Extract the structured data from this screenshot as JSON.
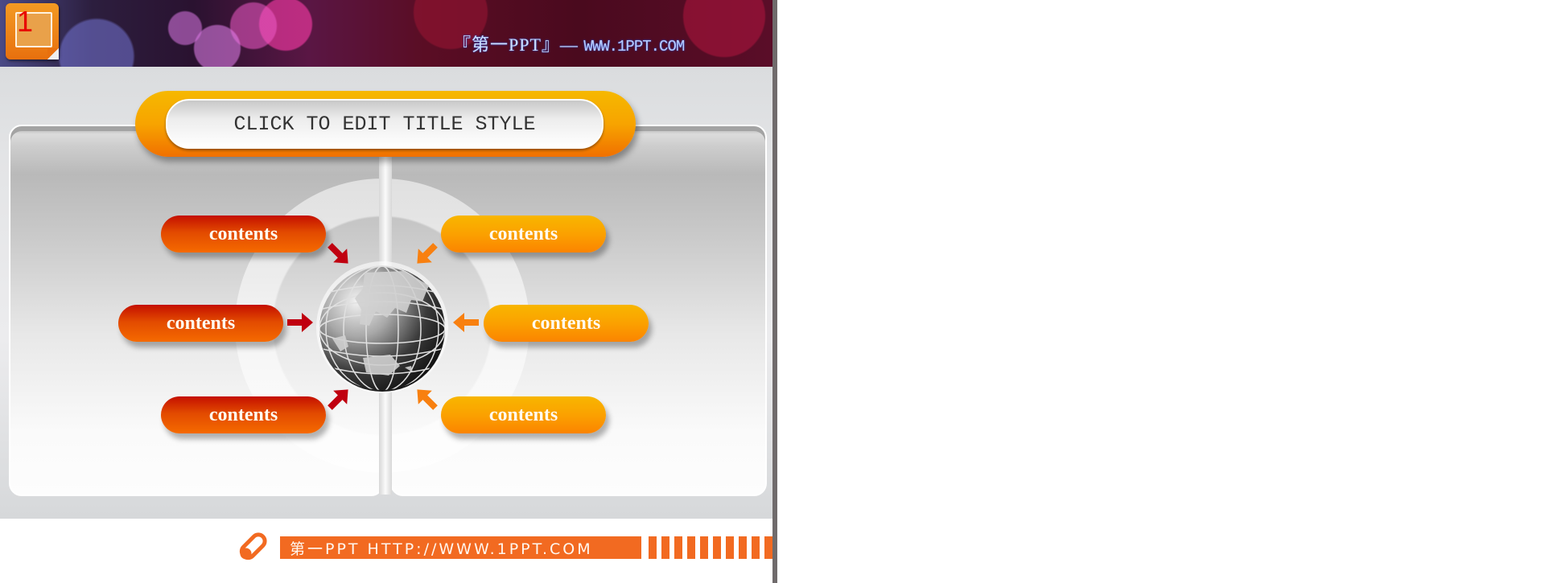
{
  "slide": {
    "slide_number": "1",
    "header": {
      "brand_text": "『第一PPT』—",
      "url_text": "WWW.1PPT.COM"
    },
    "title": "CLICK TO EDIT TITLE STYLE",
    "left_items": [
      {
        "label": "contents"
      },
      {
        "label": "contents"
      },
      {
        "label": "contents"
      }
    ],
    "right_items": [
      {
        "label": "contents"
      },
      {
        "label": "contents"
      },
      {
        "label": "contents"
      }
    ],
    "center_icon": "globe-icon",
    "footer": {
      "text": "第一PPT HTTP://WWW.1PPT.COM",
      "icon": "pencil-icon"
    }
  },
  "colors": {
    "accent_orange": "#f26a21",
    "pill_red": "#e24a00",
    "pill_orange": "#fba100",
    "arrow_red": "#c00010",
    "arrow_orange": "#f88010"
  }
}
